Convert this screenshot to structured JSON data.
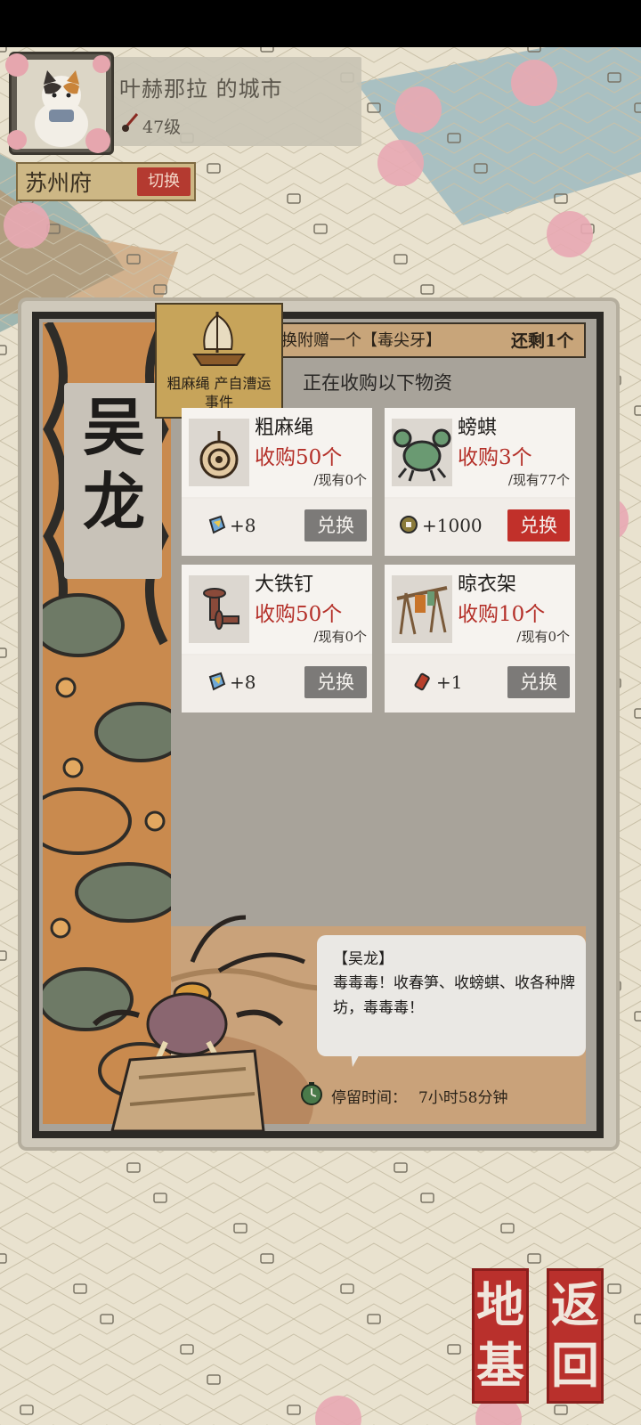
{
  "header": {
    "city_name": "叶赫那拉 的城市",
    "level": "47级",
    "region": "苏州府",
    "switch_label": "切换"
  },
  "panel": {
    "merchant_name": "吴龙",
    "promo_text": "换附赠一个【毒尖牙】",
    "promo_remaining": "还剩1个",
    "subtitle": "正在收购以下物资",
    "source_tag": "粗麻绳 产自漕运事件",
    "items": [
      {
        "name": "粗麻绳",
        "request": "收购50个",
        "owned": "/现有0个",
        "reward_icon": "colored-gem-icon",
        "reward": "+8",
        "button": "兑换",
        "enabled": false
      },
      {
        "name": "螃蜞",
        "request": "收购3个",
        "owned": "/现有77个",
        "reward_icon": "copper-coin-icon",
        "reward": "+1000",
        "button": "兑换",
        "enabled": true
      },
      {
        "name": "大铁钉",
        "request": "收购50个",
        "owned": "/现有0个",
        "reward_icon": "colored-gem-icon",
        "reward": "+8",
        "button": "兑换",
        "enabled": false
      },
      {
        "name": "晾衣架",
        "request": "收购10个",
        "owned": "/现有0个",
        "reward_icon": "firecracker-icon",
        "reward": "+1",
        "button": "兑换",
        "enabled": false
      }
    ],
    "dialog": {
      "speaker": "【吴龙】",
      "text": "毒毒毒！收春笋、收螃蜞、收各种牌坊，毒毒毒！"
    },
    "stay_label": "停留时间：",
    "stay_value": "7小时58分钟"
  },
  "seals": {
    "return_label": "返回",
    "base_label": "地基"
  },
  "colors": {
    "accent_red": "#c1302a",
    "disabled_gray": "#7c7a78",
    "request_red": "#b42f28"
  }
}
